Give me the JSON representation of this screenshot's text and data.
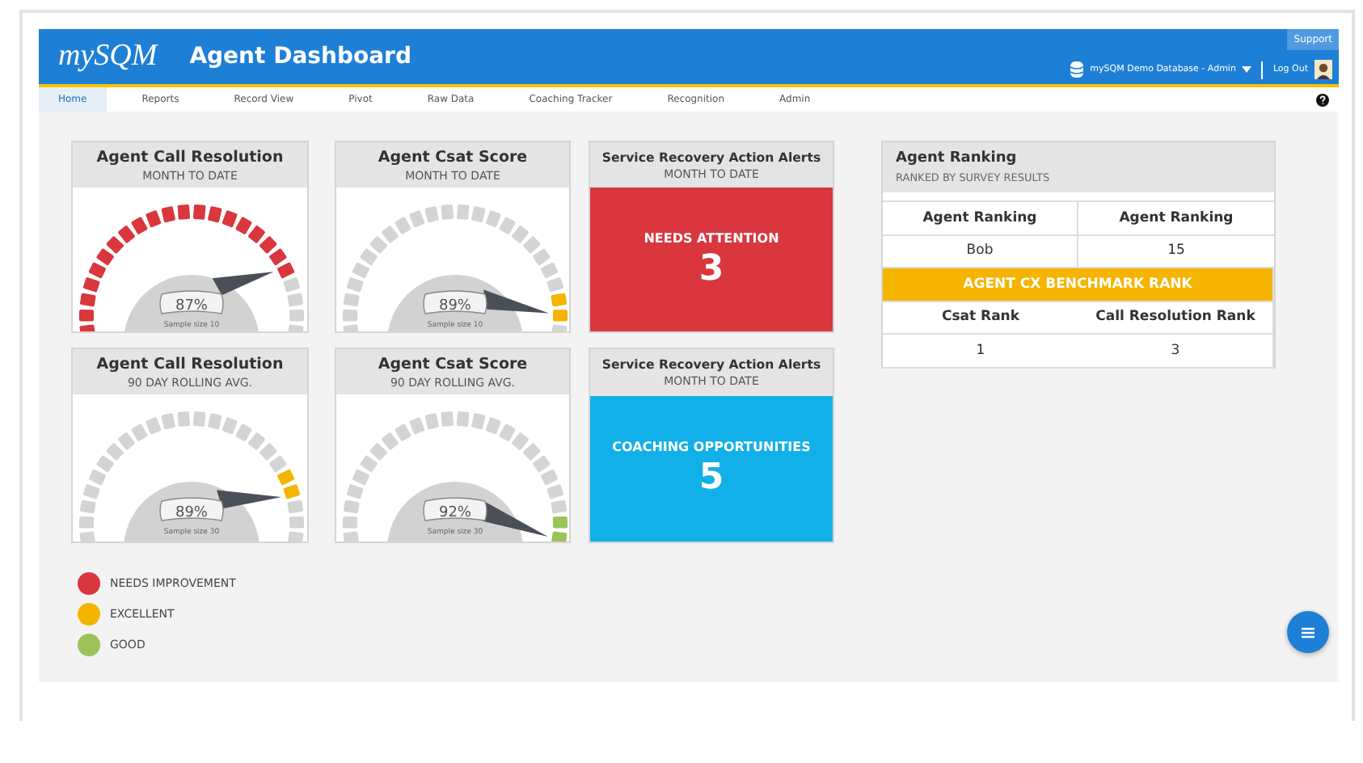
{
  "header": {
    "logo": "mySQM",
    "title": "Agent Dashboard",
    "support": "Support",
    "database": "mySQM Demo Database - Admin",
    "logout": "Log Out"
  },
  "nav": [
    {
      "label": "Home",
      "selected": true
    },
    {
      "label": "Reports",
      "selected": false
    },
    {
      "label": "Record View",
      "selected": false
    },
    {
      "label": "Pivot",
      "selected": false
    },
    {
      "label": "Raw Data",
      "selected": false
    },
    {
      "label": "Coaching Tracker",
      "selected": false
    },
    {
      "label": "Recognition",
      "selected": false
    },
    {
      "label": "Admin",
      "selected": false
    }
  ],
  "gauges": [
    {
      "title": "Agent Call Resolution",
      "subtitle": "MONTH TO DATE",
      "value": "87%",
      "sample": "Sample size 10",
      "color": "#d9363e",
      "kind": "filled"
    },
    {
      "title": "Agent Csat Score",
      "subtitle": "MONTH TO DATE",
      "value": "89%",
      "sample": "Sample size 10",
      "color": "#f5b400",
      "kind": "marker"
    },
    {
      "title": "Agent Call Resolution",
      "subtitle": "90 DAY ROLLING AVG.",
      "value": "89%",
      "sample": "Sample size 30",
      "color": "#f5b400",
      "kind": "marker"
    },
    {
      "title": "Agent Csat Score",
      "subtitle": "90 DAY ROLLING AVG.",
      "value": "92%",
      "sample": "Sample size 30",
      "color": "#9bc35a",
      "kind": "marker"
    }
  ],
  "alerts": [
    {
      "title": "Service Recovery Action Alerts",
      "subtitle": "MONTH TO DATE",
      "label": "NEEDS ATTENTION",
      "count": "3",
      "color": "#d9363e"
    },
    {
      "title": "Service Recovery Action Alerts",
      "subtitle": "MONTH TO DATE",
      "label": "COACHING OPPORTUNITIES",
      "count": "5",
      "color": "#12b0e8"
    }
  ],
  "ranking": {
    "title": "Agent Ranking",
    "subtitle": "RANKED BY SURVEY RESULTS",
    "rows": [
      {
        "kind": "head",
        "cells": [
          "Agent Ranking",
          "Agent Ranking"
        ]
      },
      {
        "kind": "cell",
        "cells": [
          "Bob",
          "15"
        ]
      },
      {
        "kind": "banner",
        "cells": [
          "AGENT CX BENCHMARK RANK"
        ]
      },
      {
        "kind": "head",
        "cells": [
          "Csat Rank",
          "Call Resolution Rank"
        ]
      },
      {
        "kind": "cell",
        "cells": [
          "1",
          "3"
        ]
      }
    ]
  },
  "legend": [
    {
      "label": "NEEDS IMPROVEMENT",
      "color": "#d9363e"
    },
    {
      "label": "EXCELLENT",
      "color": "#f5b400"
    },
    {
      "label": "GOOD",
      "color": "#9bc35a"
    }
  ]
}
